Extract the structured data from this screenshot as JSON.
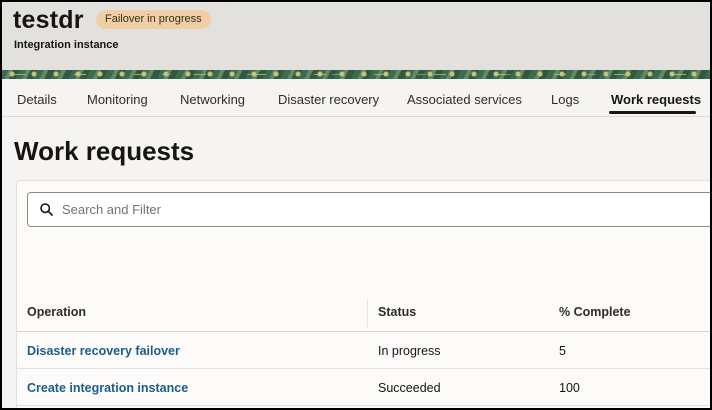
{
  "header": {
    "title": "testdr",
    "badge": "Failover in progress",
    "subtitle": "Integration instance"
  },
  "tabs": [
    {
      "label": "Details"
    },
    {
      "label": "Monitoring"
    },
    {
      "label": "Networking"
    },
    {
      "label": "Disaster recovery"
    },
    {
      "label": "Associated services"
    },
    {
      "label": "Logs"
    },
    {
      "label": "Work requests",
      "active": true
    }
  ],
  "page": {
    "title": "Work requests"
  },
  "search": {
    "placeholder": "Search and Filter",
    "value": ""
  },
  "table": {
    "columns": [
      "Operation",
      "Status",
      "% Complete"
    ],
    "rows": [
      {
        "operation": "Disaster recovery failover",
        "status": "In progress",
        "complete": "5"
      },
      {
        "operation": "Create integration instance",
        "status": "Succeeded",
        "complete": "100"
      }
    ]
  },
  "icons": {
    "search": "search-icon"
  },
  "colors": {
    "badge": "#f0cfa6",
    "link": "#1c5d89",
    "active_tab_underline": "#161513"
  }
}
